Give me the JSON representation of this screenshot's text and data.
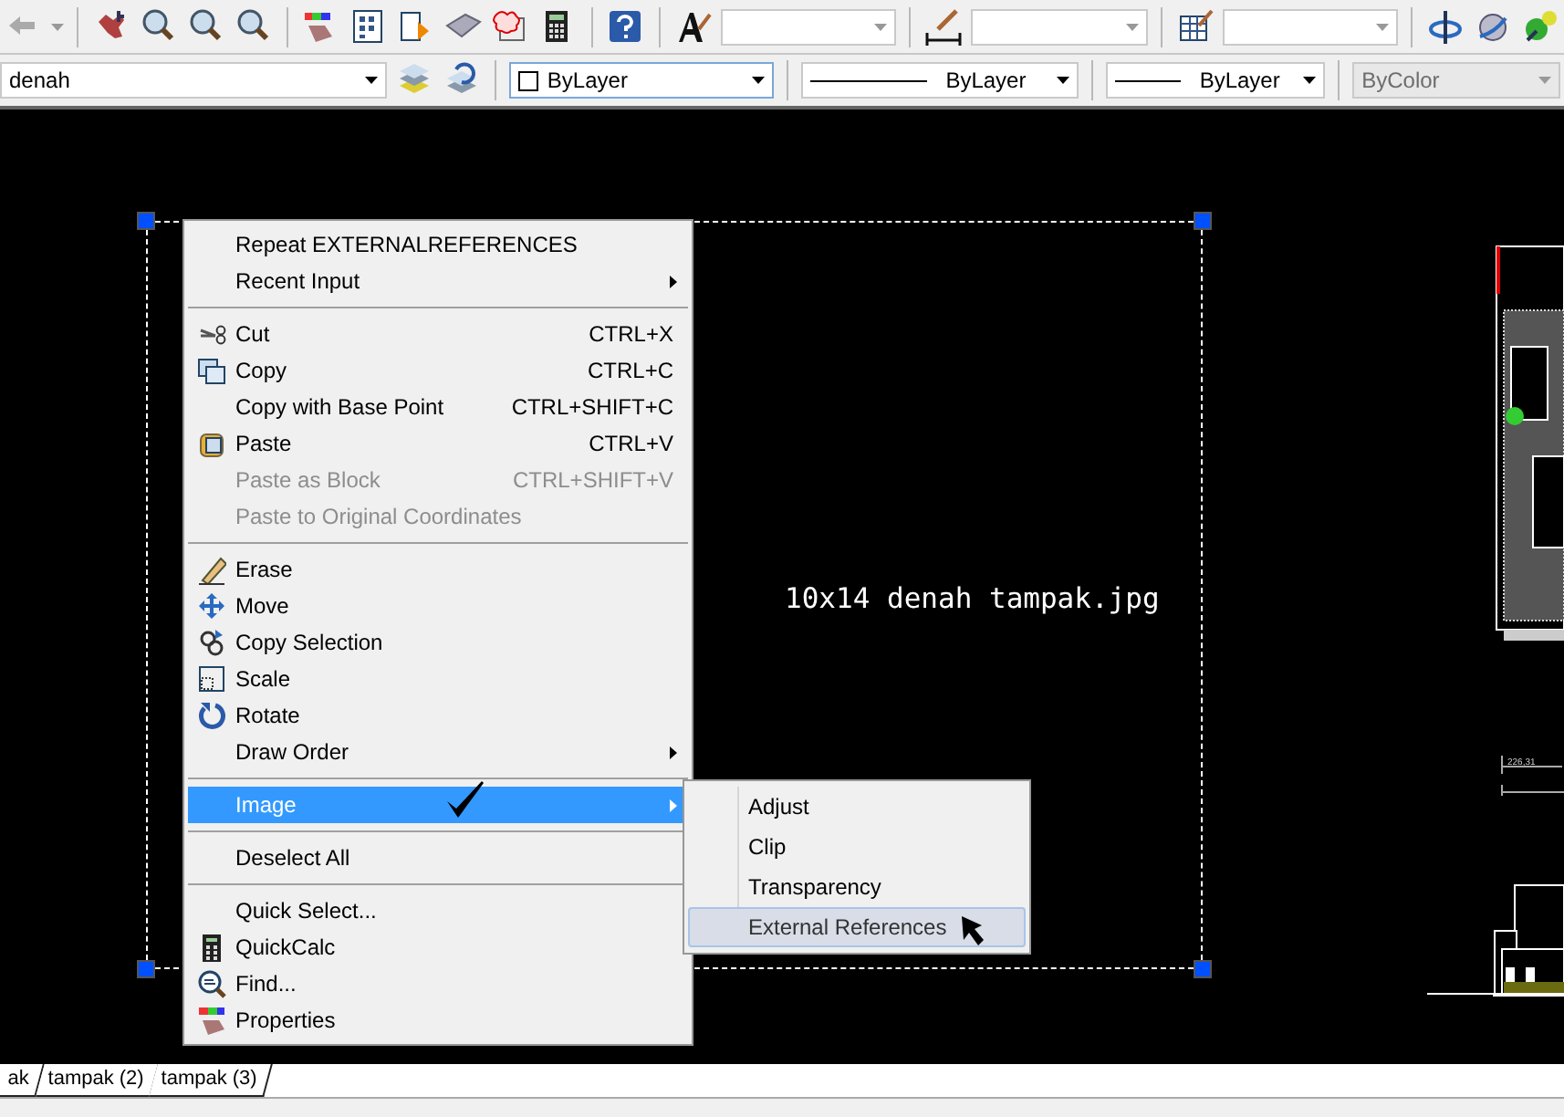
{
  "toolbar_properties": {
    "layer": {
      "value": "denah"
    },
    "color": {
      "value": "ByLayer"
    },
    "linetype": {
      "value": "ByLayer"
    },
    "lineweight": {
      "value": "ByLayer"
    },
    "plot_style": {
      "value": "ByColor",
      "disabled": true
    }
  },
  "drawing": {
    "image_name": "10x14 denah tampak.jpg",
    "dimension": "226,31"
  },
  "context_menu": {
    "items": [
      {
        "kind": "item",
        "label": "Repeat EXTERNALREFERENCES",
        "disabled": false,
        "selected": false,
        "submenu": false
      },
      {
        "kind": "item",
        "label": "Recent Input",
        "disabled": false,
        "selected": false,
        "submenu": true
      },
      {
        "kind": "separator"
      },
      {
        "kind": "item",
        "label": "Cut",
        "shortcut": "CTRL+X",
        "disabled": false,
        "selected": false,
        "submenu": false
      },
      {
        "kind": "item",
        "label": "Copy",
        "shortcut": "CTRL+C",
        "disabled": false,
        "selected": false,
        "submenu": false
      },
      {
        "kind": "item",
        "label": "Copy with Base Point",
        "shortcut": "CTRL+SHIFT+C",
        "disabled": false,
        "selected": false,
        "submenu": false
      },
      {
        "kind": "item",
        "label": "Paste",
        "shortcut": "CTRL+V",
        "disabled": false,
        "selected": false,
        "submenu": false
      },
      {
        "kind": "item",
        "label": "Paste as Block",
        "shortcut": "CTRL+SHIFT+V",
        "disabled": true,
        "selected": false,
        "submenu": false
      },
      {
        "kind": "item",
        "label": "Paste to Original Coordinates",
        "disabled": true,
        "selected": false,
        "submenu": false
      },
      {
        "kind": "separator"
      },
      {
        "kind": "item",
        "label": "Erase",
        "disabled": false,
        "selected": false,
        "submenu": false
      },
      {
        "kind": "item",
        "label": "Move",
        "disabled": false,
        "selected": false,
        "submenu": false
      },
      {
        "kind": "item",
        "label": "Copy Selection",
        "disabled": false,
        "selected": false,
        "submenu": false
      },
      {
        "kind": "item",
        "label": "Scale",
        "disabled": false,
        "selected": false,
        "submenu": false
      },
      {
        "kind": "item",
        "label": "Rotate",
        "disabled": false,
        "selected": false,
        "submenu": false
      },
      {
        "kind": "item",
        "label": "Draw Order",
        "disabled": false,
        "selected": false,
        "submenu": true
      },
      {
        "kind": "separator"
      },
      {
        "kind": "item",
        "label": "Image",
        "disabled": false,
        "selected": true,
        "submenu": true
      },
      {
        "kind": "separator"
      },
      {
        "kind": "item",
        "label": "Deselect All",
        "disabled": false,
        "selected": false,
        "submenu": false
      },
      {
        "kind": "separator"
      },
      {
        "kind": "item",
        "label": "Quick Select...",
        "disabled": false,
        "selected": false,
        "submenu": false
      },
      {
        "kind": "item",
        "label": "QuickCalc",
        "disabled": false,
        "selected": false,
        "submenu": false
      },
      {
        "kind": "item",
        "label": "Find...",
        "disabled": false,
        "selected": false,
        "submenu": false
      },
      {
        "kind": "item",
        "label": "Properties",
        "disabled": false,
        "selected": false,
        "submenu": false
      }
    ]
  },
  "submenu": {
    "items": [
      {
        "label": "Adjust",
        "selected": false
      },
      {
        "label": "Clip",
        "selected": false
      },
      {
        "label": "Transparency",
        "selected": false
      },
      {
        "label": "External References",
        "selected": true
      }
    ]
  },
  "layout_tabs": [
    {
      "label": "ak",
      "selected": false
    },
    {
      "label": "tampak (2)",
      "selected": false
    },
    {
      "label": "tampak (3)",
      "selected": false
    }
  ]
}
